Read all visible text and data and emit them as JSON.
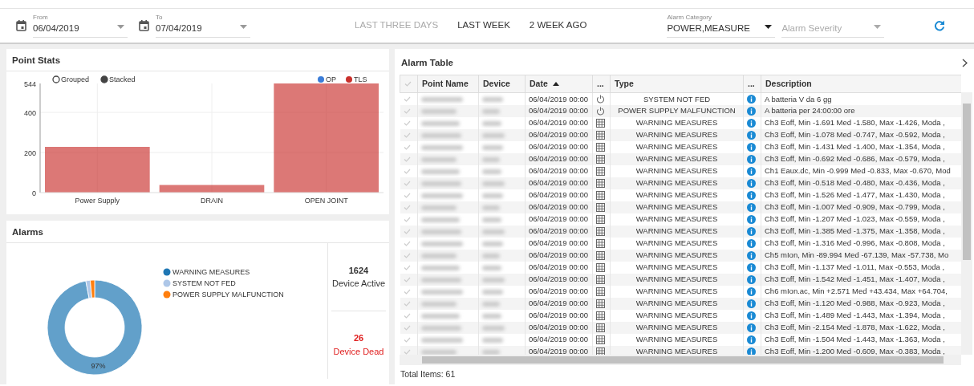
{
  "filters": {
    "from": {
      "label": "From",
      "value": "06/04/2019"
    },
    "to": {
      "label": "To",
      "value": "07/04/2019"
    },
    "quick_ranges": [
      {
        "label": "LAST THREE DAYS",
        "disabled": true
      },
      {
        "label": "LAST WEEK",
        "disabled": false
      },
      {
        "label": "2 WEEK AGO",
        "disabled": false
      }
    ],
    "category": {
      "label": "Alarm Category",
      "value": "POWER,MEASURE"
    },
    "severity": {
      "placeholder": "Alarm Severity"
    }
  },
  "point_stats": {
    "title": "Point Stats",
    "modes": [
      {
        "label": "Grouped",
        "selected": false
      },
      {
        "label": "Stacked",
        "selected": true
      }
    ],
    "chart_data": {
      "type": "bar",
      "categories": [
        "Power Supply",
        "DRAIN",
        "OPEN JOINT"
      ],
      "stacked": true,
      "grid": true,
      "ylim": [
        0,
        544
      ],
      "yticks": [
        0,
        200,
        400,
        544
      ],
      "series": [
        {
          "name": "OP",
          "color": "#3b7dd8",
          "values": [
            null,
            null,
            null
          ]
        },
        {
          "name": "TLS",
          "color": "#c9302c",
          "values": [
            228,
            38,
            544
          ]
        }
      ]
    }
  },
  "alarms": {
    "title": "Alarms",
    "chart_data": {
      "type": "donut",
      "categories": [
        "WARNING MEASURES",
        "SYSTEM NOT FED",
        "POWER SUPPLY MALFUNCTION"
      ],
      "values": [
        97,
        1.5,
        1.5
      ],
      "colors": [
        "#1f77b4",
        "#aec7e8",
        "#ff7f0e"
      ],
      "value_labels": [
        "97%",
        null,
        null
      ],
      "legend": "right"
    },
    "stats": [
      {
        "value": "1624",
        "label": "Device Active",
        "kind": "active"
      },
      {
        "value": "26",
        "label": "Device Dead",
        "kind": "dead"
      }
    ]
  },
  "alarm_table": {
    "title": "Alarm Table",
    "columns": [
      {
        "label": "Point Name",
        "sorted": false
      },
      {
        "label": "Device",
        "sorted": false
      },
      {
        "label": "Date",
        "sorted": true
      },
      {
        "label": "...",
        "sorted": false
      },
      {
        "label": "Type",
        "sorted": false
      },
      {
        "label": "...",
        "sorted": false
      },
      {
        "label": "Description",
        "sorted": false
      }
    ],
    "rows": [
      {
        "selected": false,
        "date": "06/04/2019 00:00",
        "kind": "power",
        "type": "SYSTEM NOT FED",
        "description": "A batteria V da 6 gg"
      },
      {
        "selected": false,
        "date": "06/04/2019 00:00",
        "kind": "power",
        "type": "POWER SUPPLY MALFUNCTION",
        "description": "A batteria per 24:00:00 ore"
      },
      {
        "selected": false,
        "date": "06/04/2019 00:00",
        "kind": "grid",
        "type": "WARNING MEASURES",
        "description": "Ch3 Eoff, Min -1.691 Med -1.580, Max -1.426, Moda ,"
      },
      {
        "selected": false,
        "date": "06/04/2019 00:00",
        "kind": "grid",
        "type": "WARNING MEASURES",
        "description": "Ch3 Eoff, Min -1.078 Med -0.747, Max -0.592, Moda ,"
      },
      {
        "selected": false,
        "date": "06/04/2019 00:00",
        "kind": "grid",
        "type": "WARNING MEASURES",
        "description": "Ch3 Eoff, Min -1.431 Med -1.400, Max -1.354, Moda ,"
      },
      {
        "selected": false,
        "date": "06/04/2019 00:00",
        "kind": "grid",
        "type": "WARNING MEASURES",
        "description": "Ch3 Eoff, Min -0.692 Med -0.686, Max -0.579, Moda ,"
      },
      {
        "selected": false,
        "date": "06/04/2019 00:00",
        "kind": "grid",
        "type": "WARNING MEASURES",
        "description": "Ch1 Eaux.dc, Min -0.999 Med -0.833, Max -0.670, Mod"
      },
      {
        "selected": false,
        "date": "06/04/2019 00:00",
        "kind": "grid",
        "type": "WARNING MEASURES",
        "description": "Ch3 Eoff, Min -0.518 Med -0.480, Max -0.436, Moda ,"
      },
      {
        "selected": false,
        "date": "06/04/2019 00:00",
        "kind": "grid",
        "type": "WARNING MEASURES",
        "description": "Ch3 Eoff, Min -1.526 Med -1.477, Max -1.430, Moda ,"
      },
      {
        "selected": false,
        "date": "06/04/2019 00:00",
        "kind": "grid",
        "type": "WARNING MEASURES",
        "description": "Ch3 Eoff, Min -1.007 Med -0.909, Max -0.799, Moda ,"
      },
      {
        "selected": false,
        "date": "06/04/2019 00:00",
        "kind": "grid",
        "type": "WARNING MEASURES",
        "description": "Ch3 Eoff, Min -1.207 Med -1.023, Max -0.559, Moda ,"
      },
      {
        "selected": false,
        "date": "06/04/2019 00:00",
        "kind": "grid",
        "type": "WARNING MEASURES",
        "description": "Ch3 Eoff, Min -1.385 Med -1.375, Max -1.358, Moda ,"
      },
      {
        "selected": false,
        "date": "06/04/2019 00:00",
        "kind": "grid",
        "type": "WARNING MEASURES",
        "description": "Ch3 Eoff, Min -1.316 Med -0.996, Max -0.808, Moda ,"
      },
      {
        "selected": false,
        "date": "06/04/2019 00:00",
        "kind": "grid",
        "type": "WARNING MEASURES",
        "description": "Ch5 mIon, Min -89.994 Med -67.139, Max -57.738, Mo"
      },
      {
        "selected": false,
        "date": "06/04/2019 00:00",
        "kind": "grid",
        "type": "WARNING MEASURES",
        "description": "Ch3 Eoff, Min -1.137 Med -1.011, Max -0.553, Moda ,"
      },
      {
        "selected": false,
        "date": "06/04/2019 00:00",
        "kind": "grid",
        "type": "WARNING MEASURES",
        "description": "Ch3 Eoff, Min -1.542 Med -1.451, Max -1.407, Moda ,"
      },
      {
        "selected": false,
        "date": "06/04/2019 00:00",
        "kind": "grid",
        "type": "WARNING MEASURES",
        "description": "Ch6 mIon.ac, Min +2.571 Med +43.434, Max +64.704,"
      },
      {
        "selected": false,
        "date": "06/04/2019 00:00",
        "kind": "grid",
        "type": "WARNING MEASURES",
        "description": "Ch3 Eoff, Min -1.120 Med -0.988, Max -0.923, Moda ,"
      },
      {
        "selected": false,
        "date": "06/04/2019 00:00",
        "kind": "grid",
        "type": "WARNING MEASURES",
        "description": "Ch3 Eoff, Min -1.489 Med -1.443, Max -1.394, Moda ,"
      },
      {
        "selected": false,
        "date": "06/04/2019 00:00",
        "kind": "grid",
        "type": "WARNING MEASURES",
        "description": "Ch3 Eoff, Min -2.154 Med -1.878, Max -1.622, Moda ,"
      },
      {
        "selected": false,
        "date": "06/04/2019 00:00",
        "kind": "grid",
        "type": "WARNING MEASURES",
        "description": "Ch3 Eoff, Min -1.504 Med -1.443, Max -1.363, Moda ,"
      },
      {
        "selected": false,
        "date": "06/04/2019 00:00",
        "kind": "grid",
        "type": "WARNING MEASURES",
        "description": "Ch3 Eoff, Min -1.200 Med -0.609, Max -0.383, Moda ,"
      }
    ],
    "footer": "Total Items: 61"
  }
}
